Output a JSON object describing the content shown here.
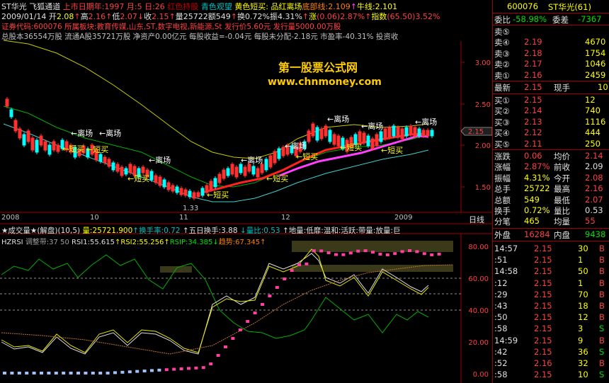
{
  "header": {
    "title": "ST华光",
    "subtitle": "飞狐通道",
    "ipo": "上市日期年:1997 月:5 日:26",
    "legend1": "红色持股",
    "legend2": "青色观望",
    "legend3": "黄色短买:",
    "legend4": "品红离场",
    "line2_prefix": "2009/01/14 开",
    "open": "2.08",
    "high_label": "高",
    "high": "2.16",
    "low_label": "低",
    "low": "2.07",
    "close_label": "收",
    "close": "2.15",
    "vol_label": "量",
    "vol": "25722",
    "amt_label": "额",
    "amt": "549",
    "turn_label": "换",
    "turn": "0.72%",
    "amp_label": "振",
    "amp": "4.31%",
    "rise_label": "涨",
    "rise": "(0.06)",
    "rise_pct": "2.87%",
    "index_label": "指数",
    "index": "(65.50)",
    "index_pct": "3.52%",
    "bottom_line": "底部线:2.109",
    "bull_line": "牛线:2.101",
    "info1": "证券代码:600076   所属板块:教育传媒,山东,ST,数字电视,新能源,St   发行价5.60元  发行量5000.00万股",
    "info2": "总股本36554万股  流通A股35721万股  净资产0.00亿元  每股收益=-0.04元  每股未分配-2.18元  市盈率-40.31%  投资收",
    "watermark1": "第一股票公式网",
    "watermark2": "www.chnmoney.com"
  },
  "price_axis": [
    "3.00",
    "2.50",
    "2.00",
    "1.50"
  ],
  "price_tag": "2.15",
  "low_tag": "1.33",
  "time_axis": [
    "2008",
    "10",
    "11",
    "12",
    "2009"
  ],
  "period_label": "日线",
  "lower_header": {
    "name": "★成交量★(解盘)(10,5)",
    "vol": "量:25721.900",
    "turn": "↑换手率:0.72",
    "turn5": "↑五日换手:3.88",
    "ratio": "↓量比:0.53",
    "level": "↑地量:低靡:温和:活跃:带量:放量:巨",
    "ind": "HZRSI",
    "adj": "调整带:37",
    "adj2": "50",
    "rsi1": "RSI1:55.615",
    "rsi2": "RSI2:55.256",
    "rsip": "RSIP:34.385",
    "trend": "趋势:67.345"
  },
  "rsi_axis": [
    "80.00",
    "60.00",
    "40.00",
    "20.00",
    "0.00"
  ],
  "right": {
    "code": "600076",
    "name": "ST华光(61)",
    "weibi_label": "委比",
    "weibi": "-58.98%",
    "weicha_label": "委差",
    "weicha": "-7367",
    "sells": [
      {
        "label": "卖⑤",
        "price": "",
        "vol": ""
      },
      {
        "label": "卖④",
        "price": "2.19",
        "vol": "4670"
      },
      {
        "label": "卖③",
        "price": "2.18",
        "vol": "1754"
      },
      {
        "label": "卖②",
        "price": "2.17",
        "vol": "1046"
      },
      {
        "label": "卖①",
        "price": "2.16",
        "vol": "2459"
      }
    ],
    "latest_label": "最新",
    "latest": "2.15",
    "cur_label": "现手",
    "cur": "10",
    "buys": [
      {
        "label": "买①",
        "price": "2.15",
        "vol": "12"
      },
      {
        "label": "买②",
        "price": "2.14",
        "vol": "740"
      },
      {
        "label": "买③",
        "price": "2.13",
        "vol": "1116"
      },
      {
        "label": "买④",
        "price": "2.12",
        "vol": "444"
      },
      {
        "label": "买⑤",
        "price": "2.11",
        "vol": "250"
      }
    ],
    "stats": [
      {
        "l1": "涨跌",
        "v1": "0.06",
        "l2": "均价",
        "v2": "2.14"
      },
      {
        "l1": "涨幅",
        "v1": "2.87%",
        "l2": "前收",
        "v2": "2.09"
      },
      {
        "l1": "振幅",
        "v1": "4.31%",
        "l2": "今开",
        "v2": "2.08"
      },
      {
        "l1": "总手",
        "v1": "25722",
        "l2": "最高",
        "v2": "2.16"
      },
      {
        "l1": "总额",
        "v1": "549",
        "l2": "最低",
        "v2": "2.07"
      },
      {
        "l1": "换手",
        "v1": "0.72%",
        "l2": "量比",
        "v2": "0.53"
      },
      {
        "l1": "分笔",
        "v1": "465",
        "l2": "均量",
        "v2": "55"
      }
    ],
    "outer_label": "外盘",
    "outer": "16284",
    "inner_label": "内盘",
    "inner": "9438",
    "ticks": [
      {
        "t": "14:57",
        "p": "2.15",
        "v": "30",
        "d": "B"
      },
      {
        "t": ":51",
        "p": "2.15",
        "v": "1",
        "d": "B"
      },
      {
        "t": "14:58",
        "p": "2.15",
        "v": "50",
        "d": "B"
      },
      {
        "t": ":12",
        "p": "2.15",
        "v": "1",
        "d": "B"
      },
      {
        "t": ":29",
        "p": "2.15",
        "v": "70",
        "d": "B"
      },
      {
        "t": ":43",
        "p": "2.15",
        "v": "18",
        "d": "B"
      },
      {
        "t": ":50",
        "p": "2.15",
        "v": "12",
        "d": "B"
      },
      {
        "t": ":58",
        "p": "2.15",
        "v": "3",
        "d": "S"
      },
      {
        "t": "14:59",
        "p": "2.15",
        "v": "9",
        "d": "B"
      },
      {
        "t": ":42",
        "p": "2.15",
        "v": "36",
        "d": "S"
      },
      {
        "t": ":52",
        "p": "2.16",
        "v": "32",
        "d": "B"
      },
      {
        "t": ":58",
        "p": "2.15",
        "v": "10",
        "d": "S"
      }
    ]
  },
  "signals": {
    "leave": "离场",
    "short_buy": "短买"
  },
  "colors": {
    "up": "#ff3030",
    "down": "#00ffff",
    "yellow_ma": "#c8c800",
    "green_ma": "#00c000",
    "magenta": "#ff40ff",
    "red_line": "#ff2020"
  }
}
